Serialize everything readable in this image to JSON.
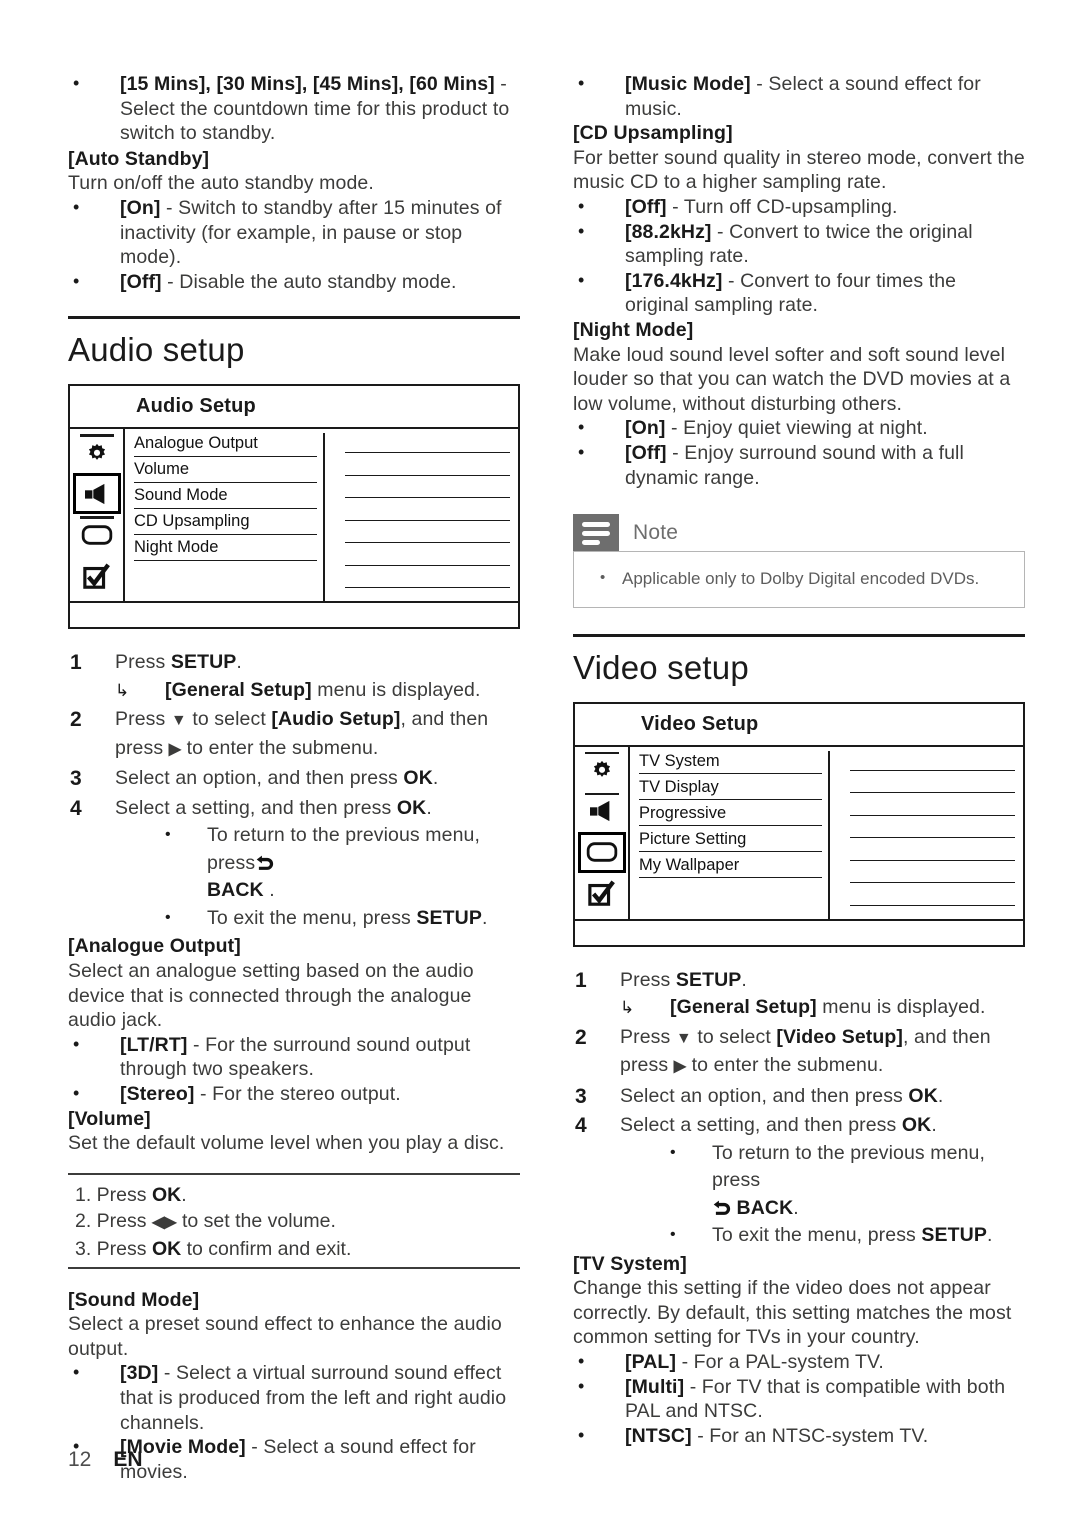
{
  "page": {
    "number": "12",
    "language": "EN"
  },
  "left_column": {
    "standby_bullet": {
      "terms": "[15 Mins], [30 Mins], [45 Mins], [60 Mins]",
      "text": " - Select the countdown time for this product to switch to standby."
    },
    "auto_standby": {
      "term": "[Auto Standby]",
      "desc": "Turn on/off the auto standby mode.",
      "options": [
        {
          "key": "[On]",
          "text": " - Switch to standby after 15 minutes of inactivity (for example, in pause or stop mode)."
        },
        {
          "key": "[Off]",
          "text": " - Disable the auto standby mode."
        }
      ]
    },
    "audio_setup_heading": "Audio setup",
    "audio_osd": {
      "title": "Audio Setup",
      "icons": [
        {
          "name": "gear-icon",
          "selected": false
        },
        {
          "name": "speaker-icon",
          "selected": true
        },
        {
          "name": "tv-icon",
          "selected": false
        },
        {
          "name": "checkbox-icon",
          "selected": false
        }
      ],
      "items": [
        "Analogue Output",
        "Volume",
        "Sound Mode",
        "CD Upsampling",
        "Night Mode"
      ],
      "value_rows": 7
    },
    "steps": [
      {
        "num": "1",
        "text_pre": "Press ",
        "bold": "SETUP",
        "text_post": ".",
        "sub_arrow_bold": "[General Setup]",
        "sub_arrow_post": " menu is displayed."
      },
      {
        "num": "2",
        "text_pre": "Press ",
        "arrow": "▼",
        "mid": " to select ",
        "bold": "[Audio Setup]",
        "text_post": ", and then press ",
        "arrow2": "▶",
        "tail": " to enter the submenu."
      },
      {
        "num": "3",
        "text_pre": "Select an option, and then press ",
        "bold": "OK",
        "text_post": "."
      },
      {
        "num": "4",
        "text_pre": "Select a setting, and then press ",
        "bold": "OK",
        "text_post": "."
      }
    ],
    "step4_bullets": [
      {
        "pre": "To return to the previous menu, press",
        "icon": "back-arrow-icon",
        "bold": "BACK",
        "post": " ."
      },
      {
        "pre": "To exit the menu, press ",
        "bold": "SETUP",
        "post": "."
      }
    ],
    "analogue_output": {
      "term": "[Analogue Output]",
      "desc": "Select an analogue setting based on the audio device that is connected through the analogue audio jack.",
      "options": [
        {
          "key": "[LT/RT]",
          "text": " - For the surround sound output through two speakers."
        },
        {
          "key": "[Stereo]",
          "text": " - For the stereo output."
        }
      ]
    },
    "volume": {
      "term": "[Volume]",
      "desc": "Set the default volume level when you play a disc.",
      "steps": [
        {
          "pre": "1. Press ",
          "bold": "OK",
          "post": "."
        },
        {
          "pre": "2. Press ",
          "arrow": "◀▶",
          "post": " to set the volume."
        },
        {
          "pre": "3. Press ",
          "bold": "OK",
          "post": " to confirm and exit."
        }
      ]
    },
    "sound_mode": {
      "term": "[Sound Mode]",
      "desc": "Select a preset sound effect to enhance the audio output.",
      "options": [
        {
          "key": "[3D]",
          "text": " - Select a virtual surround sound effect that is produced from the left and right audio channels."
        },
        {
          "key": "[Movie Mode]",
          "text": " - Select a sound effect for movies."
        }
      ]
    }
  },
  "right_column": {
    "sound_mode_cont": [
      {
        "key": "[Music Mode]",
        "text": " - Select a sound effect for music."
      }
    ],
    "cd_upsampling": {
      "term": "[CD Upsampling]",
      "desc": "For better sound quality in stereo mode, convert the music CD to a higher sampling rate.",
      "options": [
        {
          "key": "[Off]",
          "text": " - Turn off CD-upsampling."
        },
        {
          "key": "[88.2kHz]",
          "text": " - Convert to twice the original sampling rate."
        },
        {
          "key": "[176.4kHz]",
          "text": " - Convert to four times the original sampling rate."
        }
      ]
    },
    "night_mode": {
      "term": "[Night Mode]",
      "desc": "Make loud sound level softer and soft sound level louder so that you can watch the DVD movies at a low volume, without disturbing others.",
      "options": [
        {
          "key": "[On]",
          "text": " - Enjoy quiet viewing at night."
        },
        {
          "key": "[Off]",
          "text": " - Enjoy surround sound with a full dynamic range."
        }
      ]
    },
    "note": {
      "label": "Note",
      "items": [
        "Applicable only to Dolby Digital encoded DVDs."
      ]
    },
    "video_setup_heading": "Video setup",
    "video_osd": {
      "title": "Video Setup",
      "icons": [
        {
          "name": "gear-icon",
          "selected": false
        },
        {
          "name": "speaker-icon",
          "selected": false
        },
        {
          "name": "tv-icon",
          "selected": true
        },
        {
          "name": "checkbox-icon",
          "selected": false
        }
      ],
      "items": [
        "TV System",
        "TV Display",
        "Progressive",
        "Picture Setting",
        "My Wallpaper"
      ],
      "value_rows": 7
    },
    "steps": [
      {
        "num": "1",
        "text_pre": "Press ",
        "bold": "SETUP",
        "text_post": ".",
        "sub_arrow_bold": "[General Setup]",
        "sub_arrow_post": " menu is displayed."
      },
      {
        "num": "2",
        "text_pre": "Press ",
        "arrow": "▼",
        "mid": " to select ",
        "bold": "[Video Setup]",
        "text_post": ", and then press ",
        "arrow2": "▶",
        "tail": " to enter the submenu."
      },
      {
        "num": "3",
        "text_pre": "Select an option, and then press ",
        "bold": "OK",
        "text_post": "."
      },
      {
        "num": "4",
        "text_pre": "Select a setting, and then press ",
        "bold": "OK",
        "text_post": "."
      }
    ],
    "step4_bullets": [
      {
        "pre": "To return to the previous menu, press",
        "icon": "back-arrow-icon",
        "bold": "BACK",
        "post": "."
      },
      {
        "pre": "To exit the menu, press ",
        "bold": "SETUP",
        "post": "."
      }
    ],
    "tv_system": {
      "term": "[TV System]",
      "desc": "Change this setting if the video does not appear correctly. By default, this setting matches the most common setting for TVs in your country.",
      "options": [
        {
          "key": "[PAL]",
          "text": " - For a PAL-system TV."
        },
        {
          "key": "[Multi]",
          "text": " - For TV that is compatible with both PAL and NTSC."
        },
        {
          "key": "[NTSC]",
          "text": " - For an NTSC-system TV."
        }
      ]
    }
  }
}
